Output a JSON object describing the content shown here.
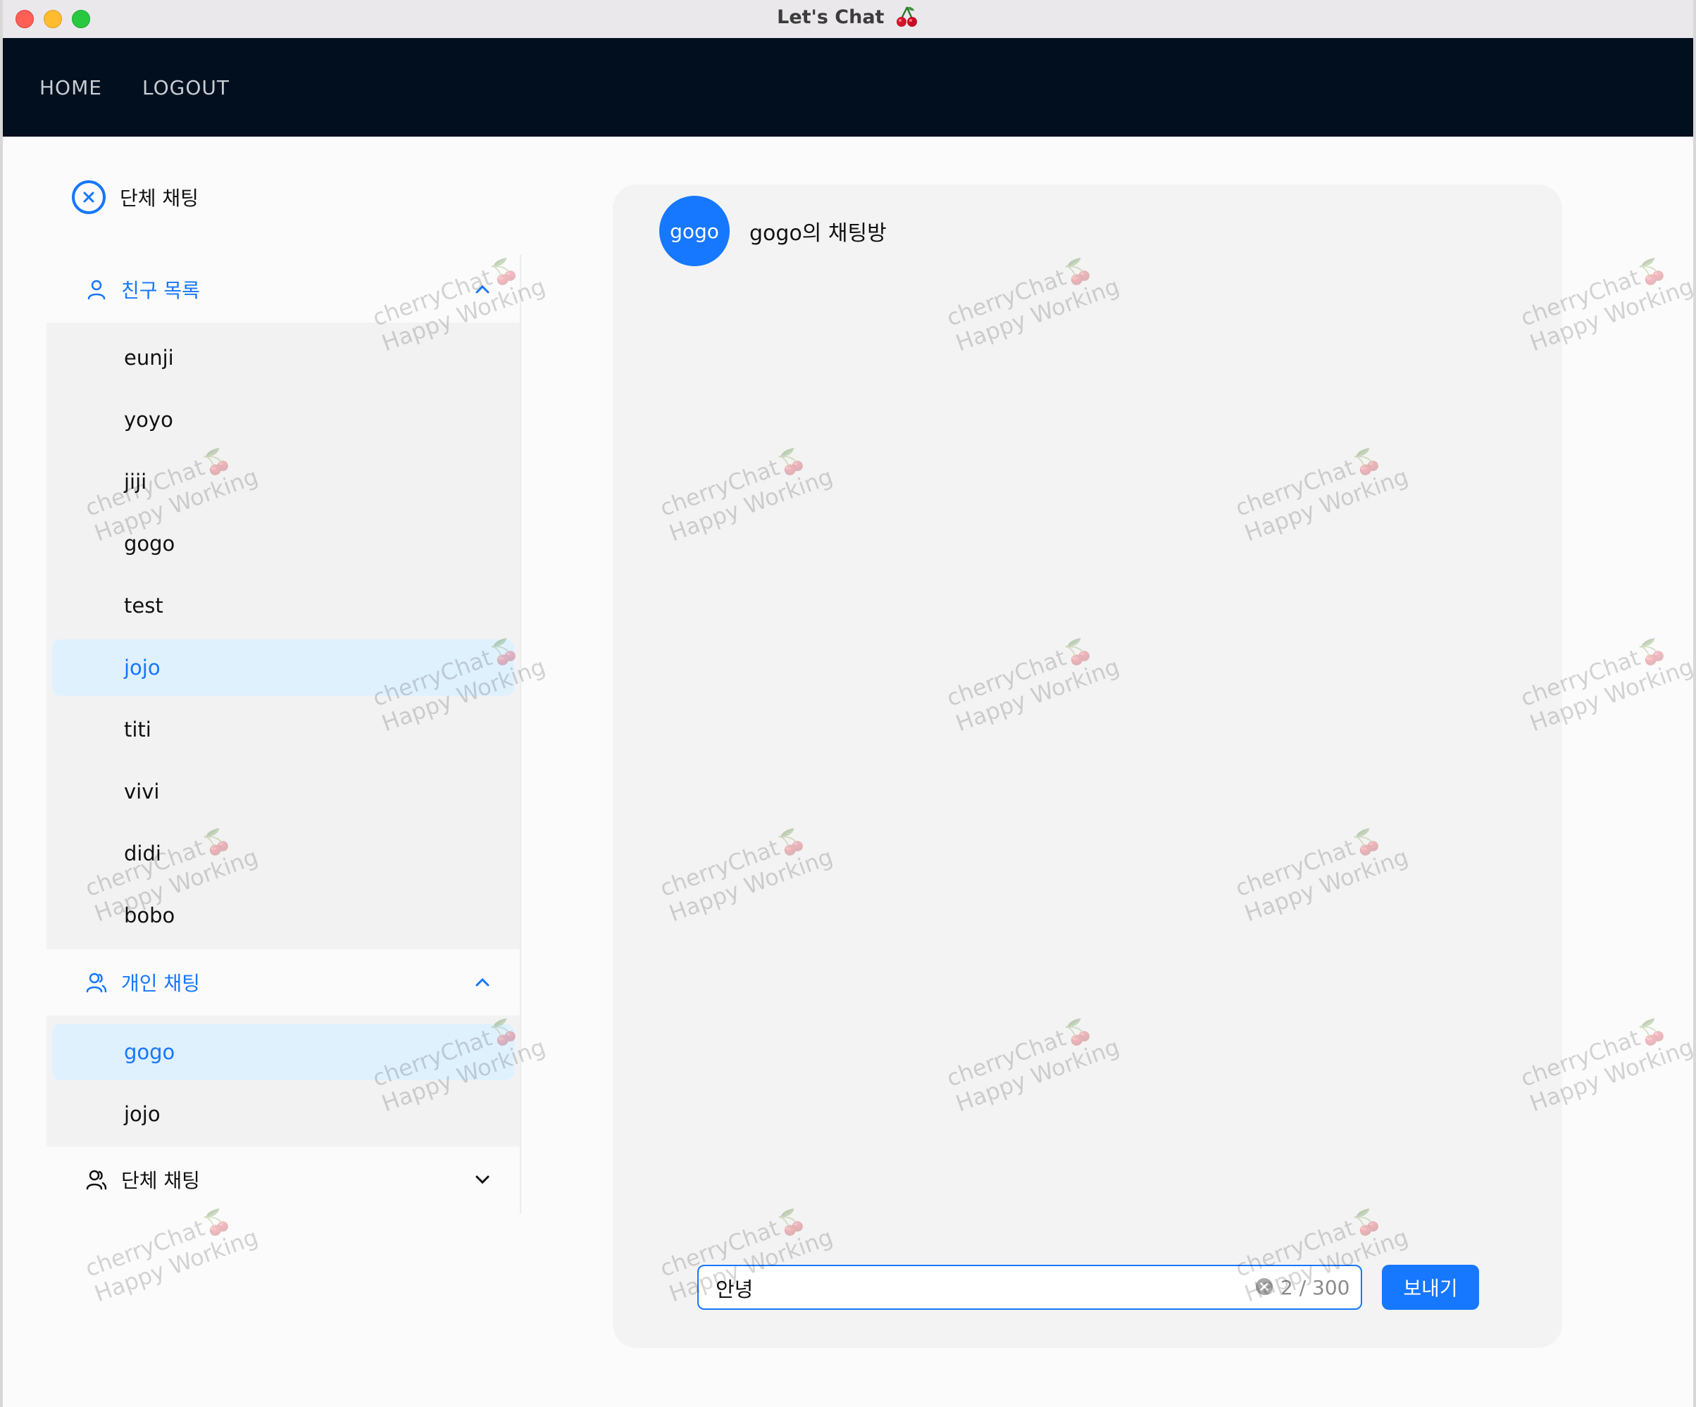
{
  "window": {
    "title": "Let's Chat"
  },
  "nav": {
    "home": "HOME",
    "logout": "LOGOUT"
  },
  "sidebar": {
    "top_group_label": "단체 채팅",
    "friends": {
      "label": "친구 목록",
      "items": [
        "eunji",
        "yoyo",
        "jiji",
        "gogo",
        "test",
        "jojo",
        "titi",
        "vivi",
        "didi",
        "bobo"
      ],
      "active": "jojo"
    },
    "private_chats": {
      "label": "개인 채팅",
      "items": [
        "gogo",
        "jojo"
      ],
      "active": "gogo"
    },
    "group_chats": {
      "label": "단체 채팅"
    }
  },
  "chat": {
    "avatar_text": "gogo",
    "room_title": "gogo의 채팅방",
    "input_value": "안녕",
    "counter": "2 / 300",
    "send_label": "보내기"
  },
  "watermark": {
    "line1": "cherryChat",
    "line2": "Happy Working"
  },
  "colors": {
    "accent": "#1677ff",
    "navbar": "#020f1f",
    "active_bg": "#e0f1fe"
  }
}
